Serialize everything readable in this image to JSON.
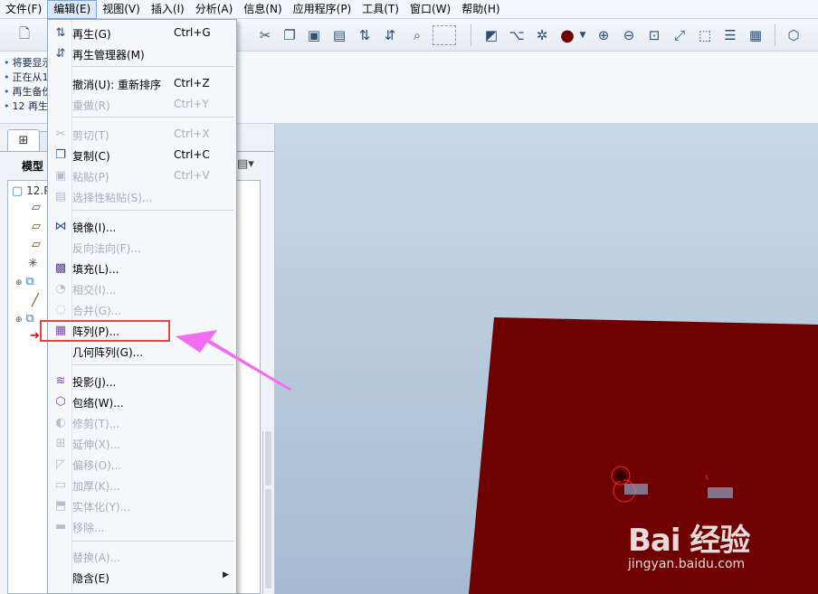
{
  "menubar": {
    "items": [
      "文件(F)",
      "编辑(E)",
      "视图(V)",
      "插入(I)",
      "分析(A)",
      "信息(N)",
      "应用程序(P)",
      "工具(T)",
      "窗口(W)",
      "帮助(H)"
    ],
    "active_index": 1
  },
  "messages": [
    "将要显示",
    "正在从1",
    "再生备份",
    "12 再生"
  ],
  "left_panel": {
    "tab_icon": "model-tree-icon",
    "title": "模型",
    "tree_root": "12.P"
  },
  "edit_menu": {
    "items": [
      {
        "label": "再生(G)",
        "shortcut": "Ctrl+G",
        "enabled": true,
        "icon": "regenerate-icon"
      },
      {
        "label": "再生管理器(M)",
        "shortcut": "",
        "enabled": true,
        "icon": "regen-manager-icon"
      },
      {
        "label": "撤消(U):  重新排序",
        "shortcut": "Ctrl+Z",
        "enabled": true,
        "icon": ""
      },
      {
        "label": "重做(R)",
        "shortcut": "Ctrl+Y",
        "enabled": false,
        "icon": ""
      },
      {
        "label": "剪切(T)",
        "shortcut": "Ctrl+X",
        "enabled": false,
        "icon": "scissors-icon"
      },
      {
        "label": "复制(C)",
        "shortcut": "Ctrl+C",
        "enabled": true,
        "icon": "copy-icon"
      },
      {
        "label": "粘贴(P)",
        "shortcut": "Ctrl+V",
        "enabled": false,
        "icon": "paste-icon"
      },
      {
        "label": "选择性粘贴(S)...",
        "shortcut": "",
        "enabled": false,
        "icon": "paste-special-icon"
      },
      {
        "label": "镜像(I)...",
        "shortcut": "",
        "enabled": true,
        "icon": "mirror-icon"
      },
      {
        "label": "反向法向(F)...",
        "shortcut": "",
        "enabled": false,
        "icon": ""
      },
      {
        "label": "填充(L)...",
        "shortcut": "",
        "enabled": true,
        "icon": "fill-icon"
      },
      {
        "label": "相交(I)...",
        "shortcut": "",
        "enabled": false,
        "icon": "intersect-icon"
      },
      {
        "label": "合并(G)...",
        "shortcut": "",
        "enabled": false,
        "icon": "merge-icon"
      },
      {
        "label": "阵列(P)...",
        "shortcut": "",
        "enabled": true,
        "icon": "pattern-icon"
      },
      {
        "label": "几何阵列(G)...",
        "shortcut": "",
        "enabled": true,
        "icon": ""
      },
      {
        "label": "投影(J)...",
        "shortcut": "",
        "enabled": true,
        "icon": "project-icon"
      },
      {
        "label": "包络(W)...",
        "shortcut": "",
        "enabled": true,
        "icon": "wrap-icon"
      },
      {
        "label": "修剪(T)...",
        "shortcut": "",
        "enabled": false,
        "icon": "trim-icon"
      },
      {
        "label": "延伸(X)...",
        "shortcut": "",
        "enabled": false,
        "icon": "extend-icon"
      },
      {
        "label": "偏移(O)...",
        "shortcut": "",
        "enabled": false,
        "icon": "offset-icon"
      },
      {
        "label": "加厚(K)...",
        "shortcut": "",
        "enabled": false,
        "icon": "thicken-icon"
      },
      {
        "label": "实体化(Y)...",
        "shortcut": "",
        "enabled": false,
        "icon": "solidify-icon"
      },
      {
        "label": "移除...",
        "shortcut": "",
        "enabled": false,
        "icon": "remove-icon"
      },
      {
        "label": "替换(A)...",
        "shortcut": "",
        "enabled": false,
        "icon": ""
      },
      {
        "label": "隐含(E)",
        "shortcut": "",
        "enabled": true,
        "icon": "",
        "submenu": true
      }
    ]
  },
  "highlight_color": "#e8453c",
  "arrow_color": "#f06cf0",
  "solid_color": "#6e0000",
  "watermark": {
    "logo": "Bai 经验",
    "url": "jingyan.baidu.com"
  }
}
